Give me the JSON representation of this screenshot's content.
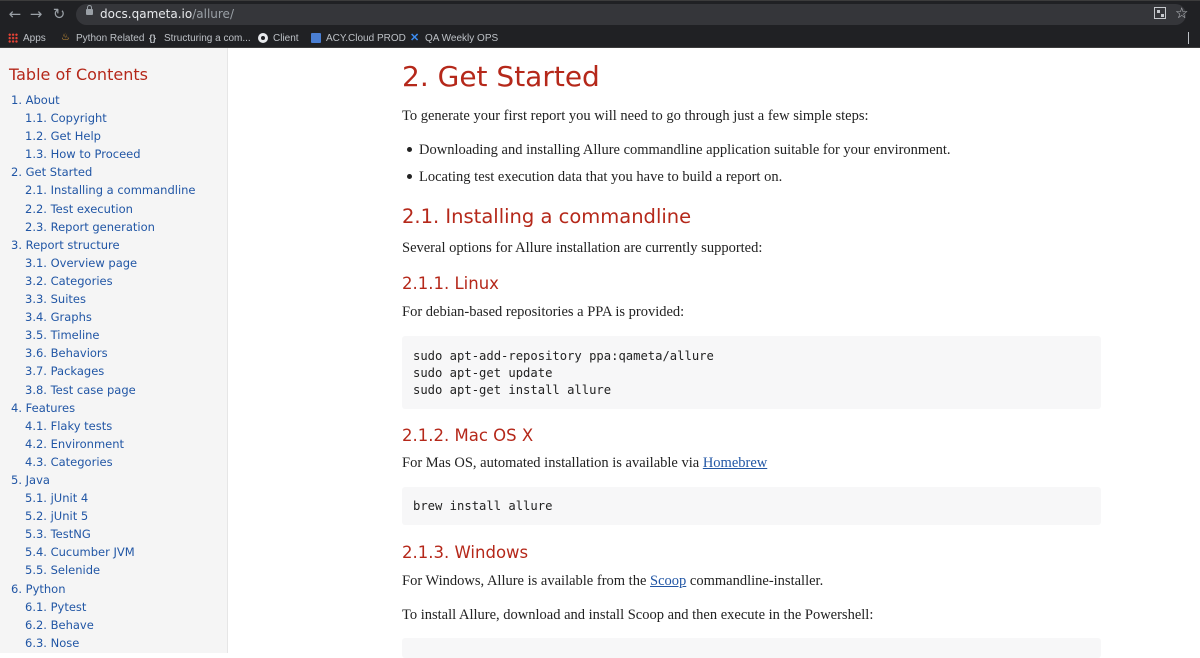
{
  "browser": {
    "url_host": "docs.qameta.io",
    "url_path": "/allure/",
    "nav": {
      "back": "←",
      "forward": "→",
      "reload": "↻"
    },
    "icons": {
      "lock": "lock-icon",
      "qr": "qr-code-icon",
      "star": "star-icon"
    },
    "bookmarks": [
      {
        "label": "Apps",
        "icon": "apps-grid-icon"
      },
      {
        "label": "Python Related",
        "icon": "python-icon"
      },
      {
        "label": "Structuring a com...",
        "icon": "curly-braces-icon"
      },
      {
        "label": "Client",
        "icon": "client-icon"
      },
      {
        "label": "ACY.Cloud PROD",
        "icon": "acy-cloud-icon"
      },
      {
        "label": "QA Weekly OPS",
        "icon": "confluence-icon"
      }
    ]
  },
  "sidebar": {
    "title": "Table of Contents",
    "items": [
      {
        "label": "1. About",
        "level": 1
      },
      {
        "label": "1.1. Copyright",
        "level": 2
      },
      {
        "label": "1.2. Get Help",
        "level": 2
      },
      {
        "label": "1.3. How to Proceed",
        "level": 2
      },
      {
        "label": "2. Get Started",
        "level": 1
      },
      {
        "label": "2.1. Installing a commandline",
        "level": 2
      },
      {
        "label": "2.2. Test execution",
        "level": 2
      },
      {
        "label": "2.3. Report generation",
        "level": 2
      },
      {
        "label": "3. Report structure",
        "level": 1
      },
      {
        "label": "3.1. Overview page",
        "level": 2
      },
      {
        "label": "3.2. Categories",
        "level": 2
      },
      {
        "label": "3.3. Suites",
        "level": 2
      },
      {
        "label": "3.4. Graphs",
        "level": 2
      },
      {
        "label": "3.5. Timeline",
        "level": 2
      },
      {
        "label": "3.6. Behaviors",
        "level": 2
      },
      {
        "label": "3.7. Packages",
        "level": 2
      },
      {
        "label": "3.8. Test case page",
        "level": 2
      },
      {
        "label": "4. Features",
        "level": 1
      },
      {
        "label": "4.1. Flaky tests",
        "level": 2
      },
      {
        "label": "4.2. Environment",
        "level": 2
      },
      {
        "label": "4.3. Categories",
        "level": 2
      },
      {
        "label": "5. Java",
        "level": 1
      },
      {
        "label": "5.1. jUnit 4",
        "level": 2
      },
      {
        "label": "5.2. jUnit 5",
        "level": 2
      },
      {
        "label": "5.3. TestNG",
        "level": 2
      },
      {
        "label": "5.4. Cucumber JVM",
        "level": 2
      },
      {
        "label": "5.5. Selenide",
        "level": 2
      },
      {
        "label": "6. Python",
        "level": 1
      },
      {
        "label": "6.1. Pytest",
        "level": 2
      },
      {
        "label": "6.2. Behave",
        "level": 2
      },
      {
        "label": "6.3. Nose",
        "level": 2
      }
    ]
  },
  "content": {
    "h2": "2. Get Started",
    "intro": "To generate your first report you will need to go through just a few simple steps:",
    "bullets": [
      "Downloading and installing Allure commandline application suitable for your environment.",
      "Locating test execution data that you have to build a report on."
    ],
    "h3_install": "2.1. Installing a commandline",
    "install_intro": "Several options for Allure installation are currently supported:",
    "linux": {
      "heading": "2.1.1. Linux",
      "text": "For debian-based repositories a PPA is provided:",
      "code": "sudo apt-add-repository ppa:qameta/allure\nsudo apt-get update\nsudo apt-get install allure"
    },
    "mac": {
      "heading": "2.1.2. Mac OS X",
      "text_before": "For Mas OS, automated installation is available via ",
      "link": "Homebrew",
      "code": "brew install allure"
    },
    "windows": {
      "heading": "2.1.3. Windows",
      "text_before": "For Windows, Allure is available from the ",
      "link": "Scoop",
      "text_after": " commandline-installer.",
      "text2": "To install Allure, download and install Scoop and then execute in the Powershell:"
    }
  }
}
